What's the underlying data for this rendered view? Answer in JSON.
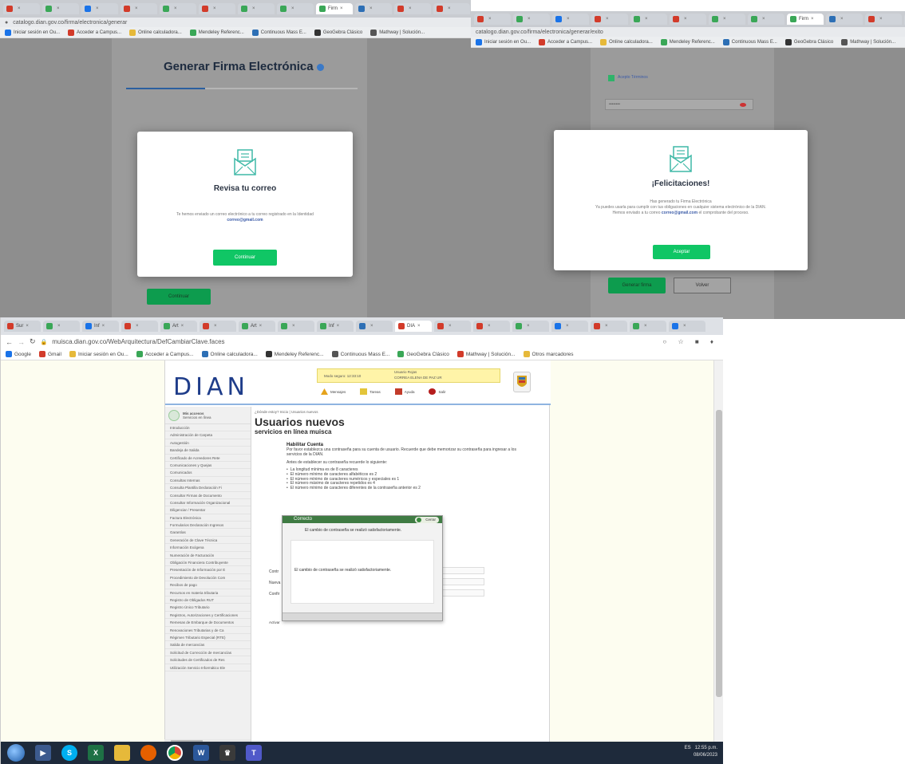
{
  "shot1": {
    "tabs": [
      "",
      "",
      "",
      "",
      "",
      "",
      "",
      "",
      "Firm",
      "",
      "",
      "",
      ""
    ],
    "active_tab_index": 8,
    "address": "catalogo.dian.gov.co/firma/electronica/generar",
    "bookmarks": [
      "Iniciar sesión en Ou...",
      "Acceder a Campus...",
      "Online calculadora...",
      "Mendeley Referenc...",
      "Continuous Mass E...",
      "GeoGebra Clásico",
      "Mathway | Solución..."
    ],
    "page_title": "Generar Firma Electrónica",
    "progress": 0.34,
    "modal": {
      "title": "Revisa tu correo",
      "body": "Te hemos enviado un correo electrónico a tu correo registrado en la Identidad",
      "email": "correo@gmail.com",
      "button": "Continuar"
    },
    "bg_button": "Continuar"
  },
  "shot2": {
    "tabs": [
      "",
      "",
      "",
      "",
      "",
      "",
      "",
      "",
      "Firm",
      "",
      "",
      "",
      ""
    ],
    "address": "catalogo.dian.gov.co/firma/electronica/generar/exito",
    "bookmarks": [
      "Iniciar sesión en Ou...",
      "Acceder a Campus...",
      "Online calculadora...",
      "Mendeley Referenc...",
      "Continuous Mass E...",
      "GeoGebra Clásico",
      "Mathway | Solución..."
    ],
    "field_value": "••••••••",
    "checkbox_label": "Acepto Términos",
    "modal": {
      "title": "¡Felicitaciones!",
      "line1": "Has generado tu Firma Electrónica",
      "line2": "Ya puedes usarla para cumplir con tus obligaciones en cualquier sistema electrónico de la DIAN.",
      "line3": "Hemos enviado a tu correo",
      "email": "correo@gmail.com",
      "line4": "el comprobante del proceso.",
      "button": "Aceptar"
    },
    "bg_buttons": [
      "Generar firma",
      "Volver"
    ]
  },
  "shot3": {
    "tabs": [
      "Sur",
      "",
      "Inf",
      "",
      "Art",
      "",
      "Art",
      "",
      "Inf",
      "",
      "DIA",
      "",
      "",
      "",
      "",
      "",
      "",
      ""
    ],
    "active_tab_index": 10,
    "address": "muisca.dian.gov.co/WebArquitectura/DefCambiarClave.faces",
    "bookmarks": [
      "Google",
      "Gmail",
      "Iniciar sesión en Ou...",
      "Acceder a Campus...",
      "Online calculadora...",
      "Mendeley Referenc...",
      "Continuous Mass E...",
      "GeoGebra Clásico",
      "Mathway | Solución...",
      "Otros marcadores"
    ],
    "dian": {
      "logo": "DIAN",
      "info_left": "Modo seguro: 12:33:10",
      "info_right_1": "Usuario Rojas",
      "info_right_2": "CORREA ELENA DE PAZ UR",
      "menu": [
        "Mensajes",
        "Tareas",
        "Ayuda",
        "Salir"
      ]
    },
    "sidebar": {
      "user": "Mis accesos",
      "user_sub": "Servicios en línea",
      "items": [
        "Introducción",
        "Administración de Carpeta",
        "Autogestión",
        "Bandeja de Salida",
        "Certificado de Acreedores Rete",
        "Comunicaciones y Quejas",
        "Comunicados",
        "Consultas Internas",
        "Consulta Plantilla Declaración Fi",
        "Consultar Firmas de Documento",
        "Consultar Información Organizacional",
        "Diligenciar / Presentar",
        "Factura Electrónica",
        "Formularios Declaración Ingresos",
        "Garantías",
        "Generación de Clave Técnica",
        "Información Exógena",
        "Numeración de Facturación",
        "Obligación Financiera Contribuyente",
        "Presentación de Información por E",
        "Procedimiento de Devolución Com",
        "Recibos de pago",
        "Recursos en materia tributaria",
        "Registro de Obligados RUT",
        "Registro Único Tributario",
        "Registros, Autorizaciones y Certificaciones",
        "Remesas de Embarque de Documentos",
        "Renovaciones Tributarias y de Ca",
        "Régimen Tributario Especial (RTE)",
        "Salida de mercancías",
        "Solicitud de Corrección de mercancías",
        "Solicitudes de Certificados de Res",
        "Utilización Servicio Informático Ele"
      ]
    },
    "breadcrumb": "¿Dónde estoy? Inicio | Usuarios nuevos",
    "heading": "Usuarios nuevos",
    "subheading": "servicios en línea muisca",
    "section_title": "Habilitar Cuenta",
    "intro": "Por favor establezca una contraseña para su cuenta de usuario. Recuerde que debe memorizar su contraseña para ingresar a los servicios de la DIAN.",
    "requirements_intro": "Antes de establecer su contraseña recuerde lo siguiente:",
    "requirements": [
      "La longitud mínima es de 8 caracteres",
      "El número mínimo de caracteres alfabéticos es 2",
      "El número mínimo de caracteres numéricos y especiales es 1",
      "El número máximo de caracteres repetidos es 4",
      "El número mínimo de caracteres diferentes de la contraseña anterior es 2"
    ],
    "form_labels": [
      "Contr",
      "Nueva",
      "Confir"
    ],
    "activate_label": "Activar",
    "dialog": {
      "title": "Correcto",
      "close": "Cerrar",
      "message": "El cambio de contraseña se realizó satisfactoriamente.",
      "body": "El cambio de contraseña se realizó satisfactoriamente."
    },
    "taskbar": {
      "apps": [
        "start",
        "media-player",
        "skype",
        "excel",
        "file-explorer",
        "firefox",
        "chrome",
        "word",
        "paint",
        "teams"
      ],
      "tray_lang": "ES",
      "time": "12:55 p.m.",
      "date": "08/06/2023"
    }
  }
}
